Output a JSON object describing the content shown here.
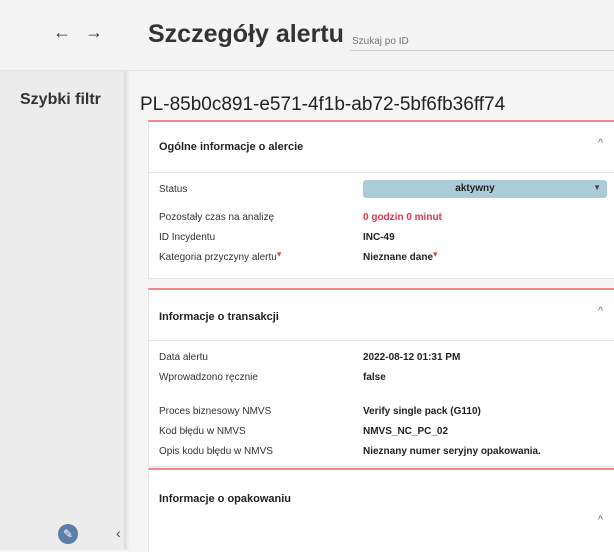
{
  "header": {
    "back_arrow": "←",
    "forward_arrow": "→",
    "title": "Szczegóły alertu",
    "search_placeholder": "Szukaj po ID"
  },
  "sidebar": {
    "title": "Szybki filtr",
    "edit_icon": "pencil-icon",
    "collapse_icon": "‹"
  },
  "alert": {
    "id": "PL-85b0c891-e571-4f1b-ab72-5bf6fb36ff74"
  },
  "general_card": {
    "title": "Ogólne informacje o alercie",
    "chevron": "^",
    "status_label": "Status",
    "status_value": "aktywny",
    "status_caret": "▼",
    "time_label": "Pozostały czas na analizę",
    "time_value": "0 godzin 0 minut",
    "incident_label": "ID Incydentu",
    "incident_value": "INC-49",
    "category_label": "Kategoria przyczyny alertu",
    "category_value": "Nieznane dane",
    "flag": "▾"
  },
  "transaction_card": {
    "title": "Informacje o transakcji",
    "chevron": "^",
    "date_label": "Data alertu",
    "date_value": "2022-08-12 01:31 PM",
    "manual_label": "Wprowadzono ręcznie",
    "manual_value": "false",
    "process_label": "Proces biznesowy NMVS",
    "process_value": "Verify single pack (G110)",
    "error_code_label": "Kod błędu w NMVS",
    "error_code_value": "NMVS_NC_PC_02",
    "error_desc_label": "Opis kodu błędu w NMVS",
    "error_desc_value": "Nieznany numer seryjny opakowania."
  },
  "package_card": {
    "title": "Informacje o opakowaniu",
    "chevron": "^"
  },
  "colors": {
    "accent_border": "#f08a8a",
    "status_bg": "#a9ccd8",
    "alert_red": "#e0334d",
    "fab": "#5b7fa8"
  }
}
